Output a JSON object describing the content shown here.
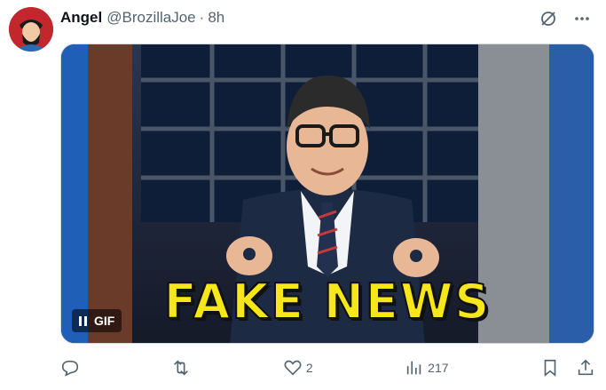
{
  "tweet": {
    "author_name": "Angel",
    "handle": "@BrozillaJoe",
    "separator": "·",
    "time": "8h"
  },
  "media": {
    "caption": "FAKE NEWS",
    "gif_label": "GIF"
  },
  "actions": {
    "likes": "2",
    "views": "217"
  },
  "icons": {
    "grok": "grok-icon",
    "more": "more-icon",
    "reply": "reply-icon",
    "retweet": "retweet-icon",
    "like": "heart-icon",
    "views": "views-icon",
    "bookmark": "bookmark-icon",
    "share": "share-icon"
  },
  "colors": {
    "secondary_text": "#536471",
    "caption_yellow": "#f5e71a",
    "avatar_bg": "#c1272d"
  }
}
